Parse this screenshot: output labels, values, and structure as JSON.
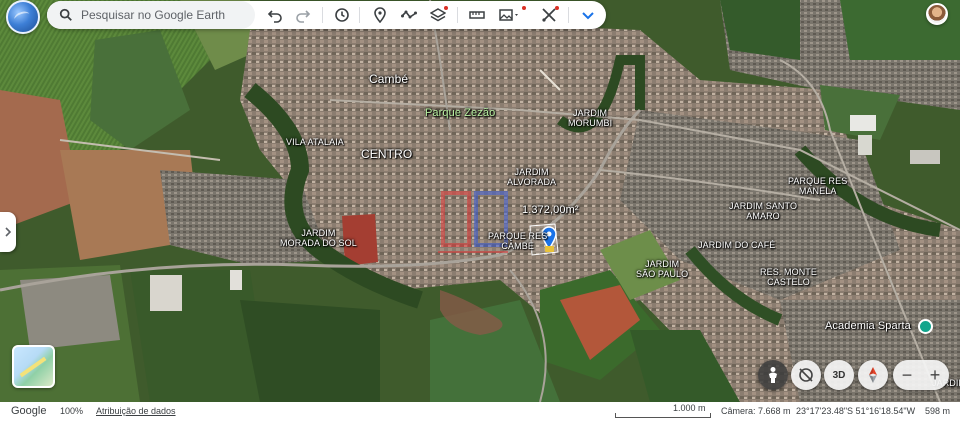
{
  "search": {
    "placeholder": "Pesquisar no Google Earth"
  },
  "toolbar": {
    "icons": [
      "undo-icon",
      "redo-icon",
      "history-icon",
      "placemark-icon",
      "path-icon",
      "layers-icon",
      "ruler-icon",
      "image-icon",
      "tools-icon",
      "expand-icon"
    ]
  },
  "map": {
    "labels": {
      "cambe": "Cambé",
      "parque_zezao": "Parque Zezão",
      "jardim_morumbi": "JARDIM\nMORUMBI",
      "vila_atalaia": "VILA ATALAIA",
      "centro": "CENTRO",
      "jardim_alvorada": "JARDIM\nALVORADA",
      "parque_res_manela": "PARQUE RES\nMANELA",
      "jardim_santo_amaro": "JARDIM SANTO\nAMARO",
      "jardim_do_cafe": "JARDIM DO CAFÉ",
      "jardim_morada_do_sol": "JARDIM\nMORADA DO SOL",
      "parque_res_cambe": "PARQUE RES\nCAMBE",
      "jardim_sao_paulo": "JARDIM\nSÃO PAULO",
      "res_monte_castelo": "RES. MONTE\nCASTELO",
      "academia_sparta": "Academia Sparta",
      "jardim_edge": "JARDIM",
      "measure": "1.372,00m²"
    }
  },
  "controls": {
    "three_d": "3D",
    "zoom_out": "−",
    "zoom_in": "+"
  },
  "status": {
    "logo": "Google",
    "zoom": "100%",
    "attribution": "Atribuição de dados",
    "scale": "1.000 m",
    "camera": "Câmera: 7.668 m",
    "coords": "23°17'23.48\"S 51°16'18.54\"W",
    "elevation": "598 m"
  }
}
